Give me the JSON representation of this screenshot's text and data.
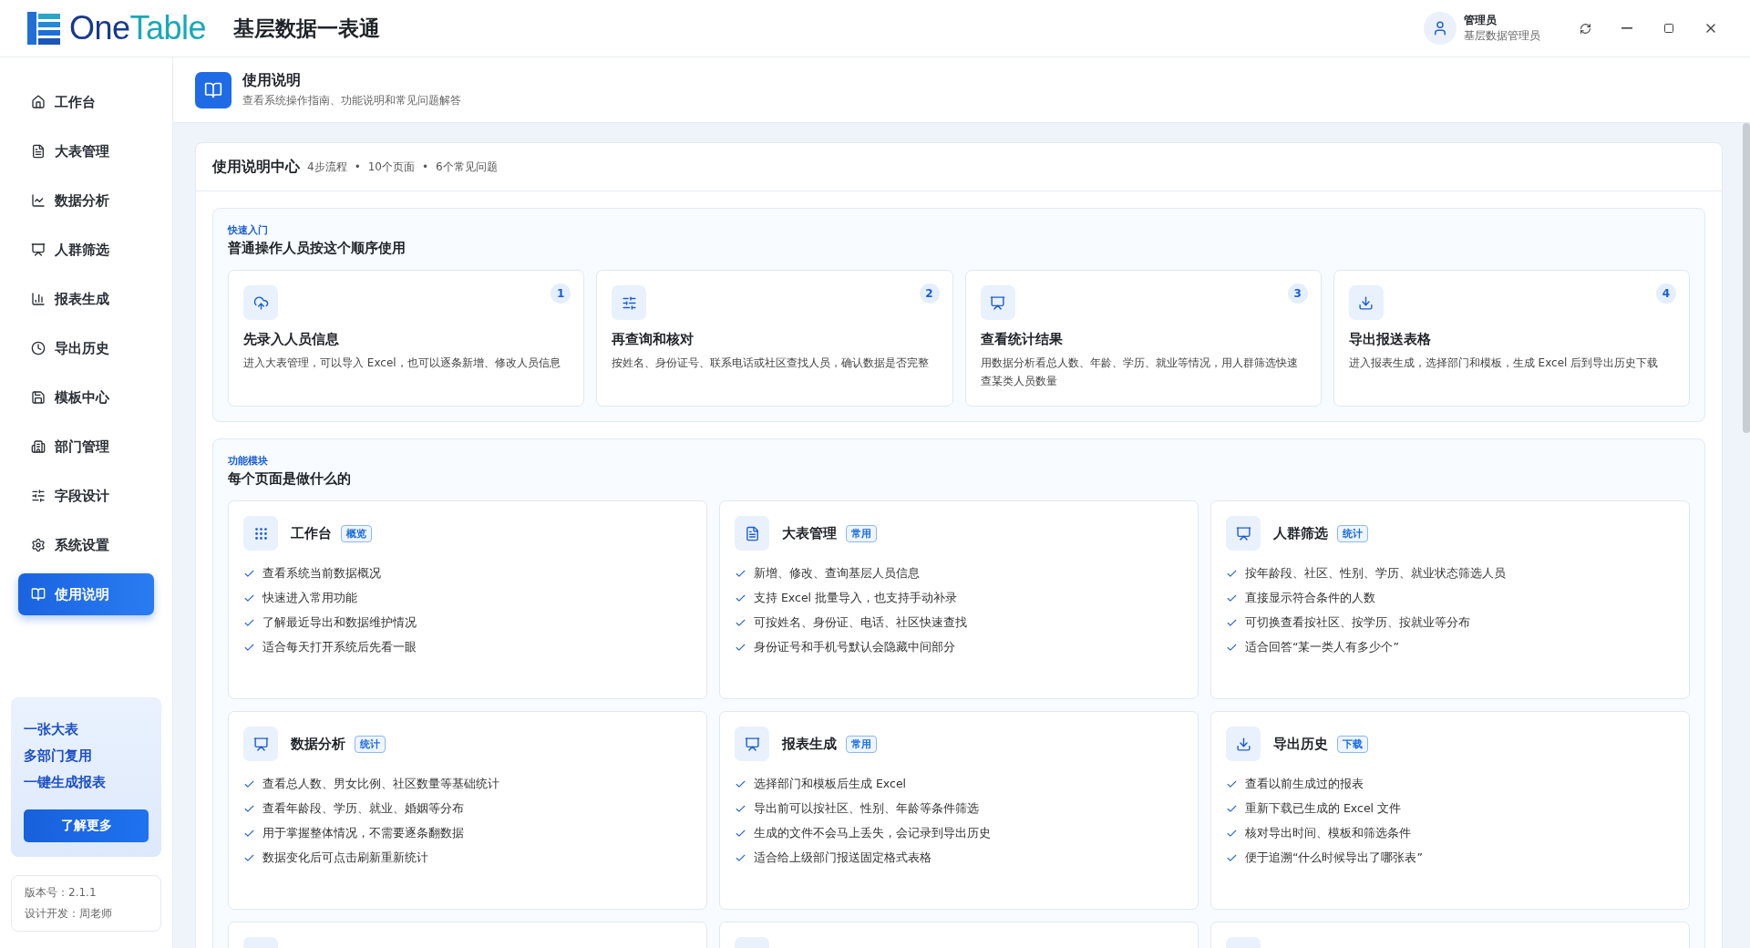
{
  "app": {
    "logo_one": "One",
    "logo_table": "Table",
    "title": "基层数据一表通"
  },
  "user": {
    "name": "管理员",
    "role": "基层数据管理员"
  },
  "sidebar": {
    "items": [
      {
        "label": "工作台",
        "selected": false
      },
      {
        "label": "大表管理",
        "selected": false
      },
      {
        "label": "数据分析",
        "selected": false
      },
      {
        "label": "人群筛选",
        "selected": false
      },
      {
        "label": "报表生成",
        "selected": false
      },
      {
        "label": "导出历史",
        "selected": false
      },
      {
        "label": "模板中心",
        "selected": false
      },
      {
        "label": "部门管理",
        "selected": false
      },
      {
        "label": "字段设计",
        "selected": false
      },
      {
        "label": "系统设置",
        "selected": false
      },
      {
        "label": "使用说明",
        "selected": true
      }
    ],
    "promo": {
      "lines": [
        "一张大表",
        "多部门复用",
        "一键生成报表"
      ],
      "button": "了解更多"
    },
    "footer": [
      "版本号：2.1.1",
      "设计开发：周老师"
    ]
  },
  "page_header": {
    "title": "使用说明",
    "subtitle": "查看系统操作指南、功能说明和常见问题解答"
  },
  "guide": {
    "title": "使用说明中心",
    "separator": "•",
    "stats": [
      "4步流程",
      "10个页面",
      "6个常见问题"
    ]
  },
  "quick_start": {
    "eyebrow": "快速入门",
    "title": "普通操作人员按这个顺序使用",
    "steps": [
      {
        "number": "1",
        "title": "先录入人员信息",
        "desc": "进入大表管理，可以导入 Excel，也可以逐条新增、修改人员信息"
      },
      {
        "number": "2",
        "title": "再查询和核对",
        "desc": "按姓名、身份证号、联系电话或社区查找人员，确认数据是否完整"
      },
      {
        "number": "3",
        "title": "查看统计结果",
        "desc": "用数据分析看总人数、年龄、学历、就业等情况，用人群筛选快速查某类人员数量"
      },
      {
        "number": "4",
        "title": "导出报送表格",
        "desc": "进入报表生成，选择部门和模板，生成 Excel 后到导出历史下载"
      }
    ]
  },
  "modules": {
    "eyebrow": "功能模块",
    "title": "每个页面是做什么的",
    "cards": [
      {
        "title": "工作台",
        "tag": "概览",
        "points": [
          "查看系统当前数据概况",
          "快速进入常用功能",
          "了解最近导出和数据维护情况",
          "适合每天打开系统后先看一眼"
        ]
      },
      {
        "title": "大表管理",
        "tag": "常用",
        "points": [
          "新增、修改、查询基层人员信息",
          "支持 Excel 批量导入，也支持手动补录",
          "可按姓名、身份证、电话、社区快速查找",
          "身份证号和手机号默认会隐藏中间部分"
        ]
      },
      {
        "title": "人群筛选",
        "tag": "统计",
        "points": [
          "按年龄段、社区、性别、学历、就业状态筛选人员",
          "直接显示符合条件的人数",
          "可切换查看按社区、按学历、按就业等分布",
          "适合回答“某一类人有多少个”"
        ]
      },
      {
        "title": "数据分析",
        "tag": "统计",
        "points": [
          "查看总人数、男女比例、社区数量等基础统计",
          "查看年龄段、学历、就业、婚姻等分布",
          "用于掌握整体情况，不需要逐条翻数据",
          "数据变化后可点击刷新重新统计"
        ]
      },
      {
        "title": "报表生成",
        "tag": "常用",
        "points": [
          "选择部门和模板后生成 Excel",
          "导出前可以按社区、性别、年龄等条件筛选",
          "生成的文件不会马上丢失，会记录到导出历史",
          "适合给上级部门报送固定格式表格"
        ]
      },
      {
        "title": "导出历史",
        "tag": "下载",
        "points": [
          "查看以前生成过的报表",
          "重新下载已生成的 Excel 文件",
          "核对导出时间、模板和筛选条件",
          "便于追溯“什么时候导出了哪张表”"
        ]
      }
    ]
  }
}
